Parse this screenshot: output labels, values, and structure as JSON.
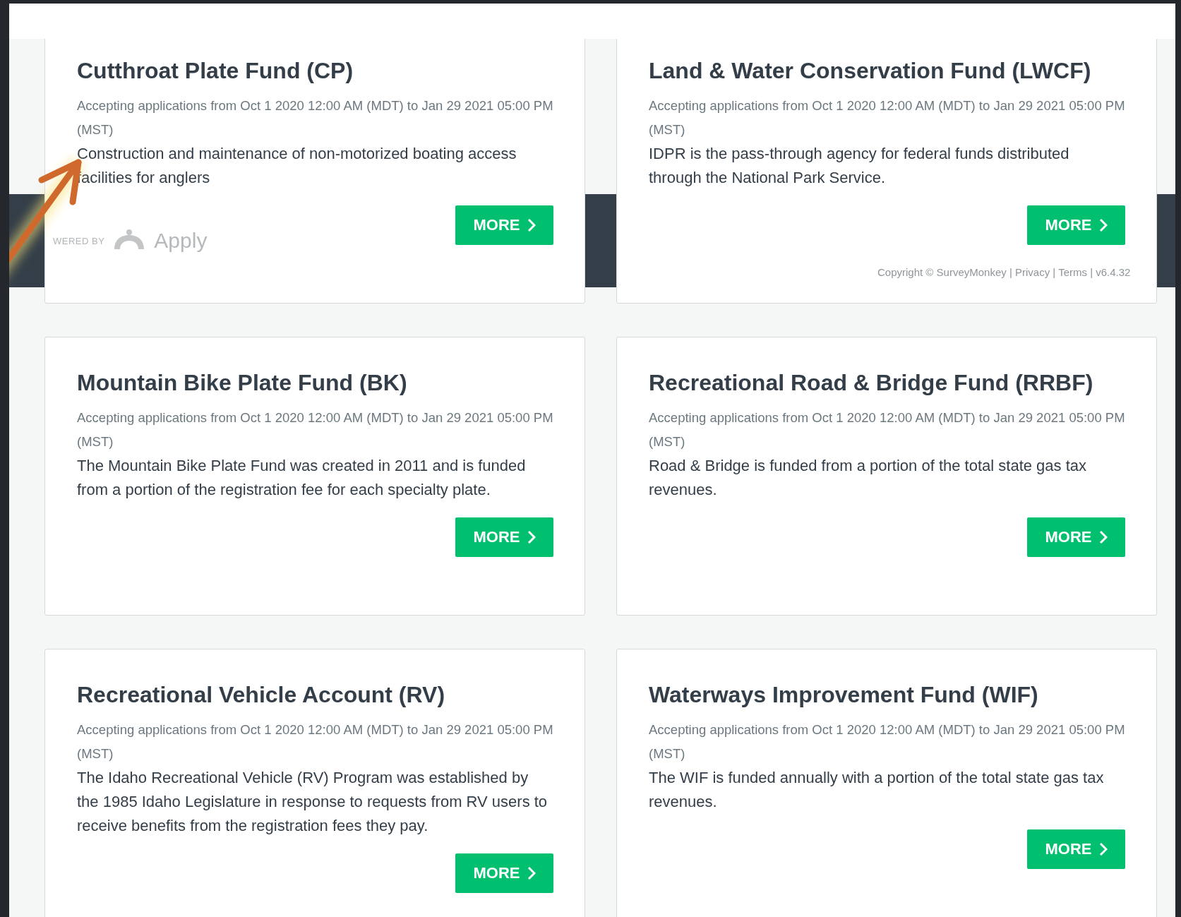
{
  "cards": [
    {
      "title": "Cutthroat Plate Fund (CP)",
      "availability": "Accepting applications from Oct 1 2020 12:00 AM (MDT) to Jan 29 2021 05:00 PM (MST)",
      "description": "Construction and maintenance of non-motorized boating access facilities for anglers",
      "button": "MORE"
    },
    {
      "title": "Land & Water Conservation Fund (LWCF)",
      "availability": "Accepting applications from Oct 1 2020 12:00 AM (MDT) to Jan 29 2021 05:00 PM (MST)",
      "description": "IDPR is the pass-through agency for federal funds distributed through the National Park Service.",
      "button": "MORE"
    },
    {
      "title": "Mountain Bike Plate Fund (BK)",
      "availability": "Accepting applications from Oct 1 2020 12:00 AM (MDT) to Jan 29 2021 05:00 PM (MST)",
      "description": "The Mountain Bike Plate Fund was created in 2011 and is funded from a portion of the registration fee for each specialty plate.",
      "button": "MORE"
    },
    {
      "title": "Recreational Road & Bridge Fund (RRBF)",
      "availability": "Accepting applications from Oct 1 2020 12:00 AM (MDT) to Jan 29 2021 05:00 PM (MST)",
      "description": "Road & Bridge is funded from a portion of the total state gas tax revenues.",
      "button": "MORE"
    },
    {
      "title": "Recreational Vehicle Account (RV)",
      "availability": "Accepting applications from Oct 1 2020 12:00 AM (MDT) to Jan 29 2021 05:00 PM (MST)",
      "description": "The Idaho Recreational Vehicle (RV) Program was established by the 1985 Idaho Legislature in response to requests from RV users to receive benefits from the registration fees they pay.",
      "button": "MORE"
    },
    {
      "title": "Waterways Improvement Fund (WIF)",
      "availability": "Accepting applications from Oct 1 2020 12:00 AM (MDT) to Jan 29 2021 05:00 PM (MST)",
      "description": "The WIF is funded annually with a portion of the total state gas tax revenues.",
      "button": "MORE"
    }
  ],
  "footer": {
    "powered_by": "WERED BY",
    "logo_text": "Apply",
    "copyright": "Copyright © SurveyMonkey | Privacy | Terms | v6.4.32"
  }
}
